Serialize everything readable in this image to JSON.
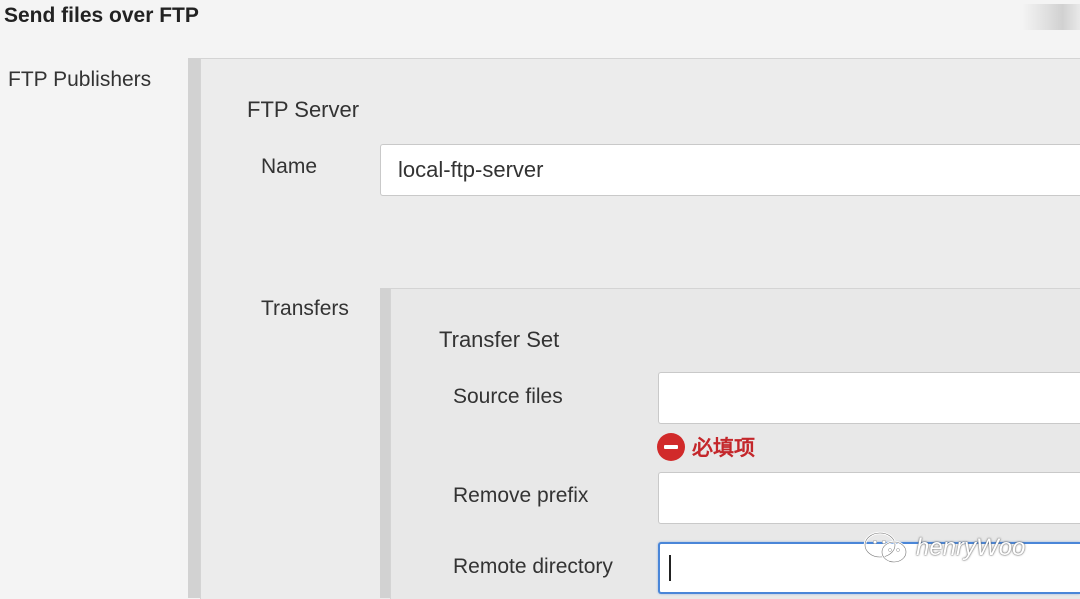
{
  "section": {
    "title": "Send files over FTP"
  },
  "ftp_publishers": {
    "label": "FTP Publishers"
  },
  "ftp_server": {
    "heading": "FTP Server",
    "name_label": "Name",
    "name_value": "local-ftp-server"
  },
  "transfers": {
    "label": "Transfers",
    "transfer_set": {
      "heading": "Transfer Set",
      "source_files_label": "Source files",
      "source_files_value": "",
      "required_message": "必填项",
      "remove_prefix_label": "Remove prefix",
      "remove_prefix_value": "",
      "remote_directory_label": "Remote directory",
      "remote_directory_value": ""
    }
  },
  "watermark": {
    "text": "henryWoo",
    "icon": "wechat-icon"
  },
  "colors": {
    "error": "#c4272b",
    "focus": "#4a86d8",
    "panel": "#ececec"
  }
}
